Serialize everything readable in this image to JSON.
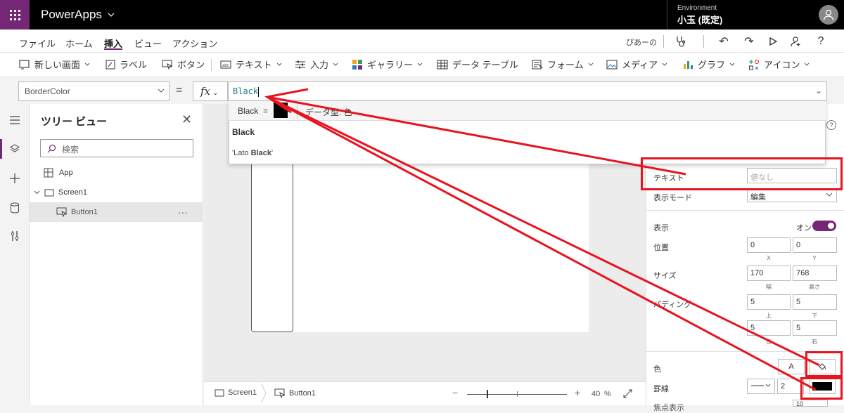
{
  "app": {
    "name": "PowerApps"
  },
  "environment": {
    "label": "Environment",
    "name": "小玉 (既定)"
  },
  "menu": {
    "items": [
      "ファイル",
      "ホーム",
      "挿入",
      "ビュー",
      "アクション"
    ],
    "active": "挿入",
    "user": "ぴあーの"
  },
  "ribbon": {
    "new_screen": "新しい画面",
    "label": "ラベル",
    "button": "ボタン",
    "text": "テキスト",
    "input": "入力",
    "gallery": "ギャラリー",
    "data_table": "データ テーブル",
    "form": "フォーム",
    "media": "メディア",
    "chart": "グラフ",
    "icon": "アイコン"
  },
  "formula_bar": {
    "property": "BorderColor",
    "equals": "=",
    "fx": "fx",
    "value": "Black"
  },
  "autocomplete": {
    "info_name": "Black",
    "info_eq": "=",
    "swatch_color": "#000000",
    "data_type": "データ型: 色",
    "suggestion_1": "Black",
    "suggestion_2_prefix": "'Lato ",
    "suggestion_2_bold": "Black",
    "suggestion_2_suffix": "'"
  },
  "tree_view": {
    "title": "ツリー ビュー",
    "search_placeholder": "検索",
    "items": [
      {
        "label": "App"
      },
      {
        "label": "Screen1"
      },
      {
        "label": "Button1",
        "more": "···"
      }
    ]
  },
  "bottom_bar": {
    "crumb_screen": "Screen1",
    "crumb_button": "Button1",
    "zoom_minus": "−",
    "zoom_plus": "+",
    "zoom_value": "40",
    "zoom_unit": "%"
  },
  "properties": {
    "text_label": "テキスト",
    "text_placeholder": "値なし",
    "display_mode_label": "表示モード",
    "display_mode_value": "編集",
    "visible_label": "表示",
    "visible_value": "オン",
    "position_label": "位置",
    "position_x": "0",
    "position_y": "0",
    "x_label": "X",
    "y_label": "Y",
    "size_label": "サイズ",
    "width": "170",
    "height": "768",
    "width_label": "幅",
    "height_label": "高さ",
    "padding_label": "パディング",
    "pad_top": "5",
    "pad_bottom": "5",
    "pad_left": "5",
    "pad_right": "5",
    "top_label": "上",
    "bottom_label": "下",
    "left_label": "左",
    "right_label": "右",
    "color_label": "色",
    "color_text_btn": "A",
    "border_label": "罫線",
    "border_width": "2",
    "border_color": "#000000",
    "next_label_partial": "焦点表示",
    "next_value_partial": "10"
  },
  "annotation_color": "#e8131e",
  "accent_color": "#742774"
}
